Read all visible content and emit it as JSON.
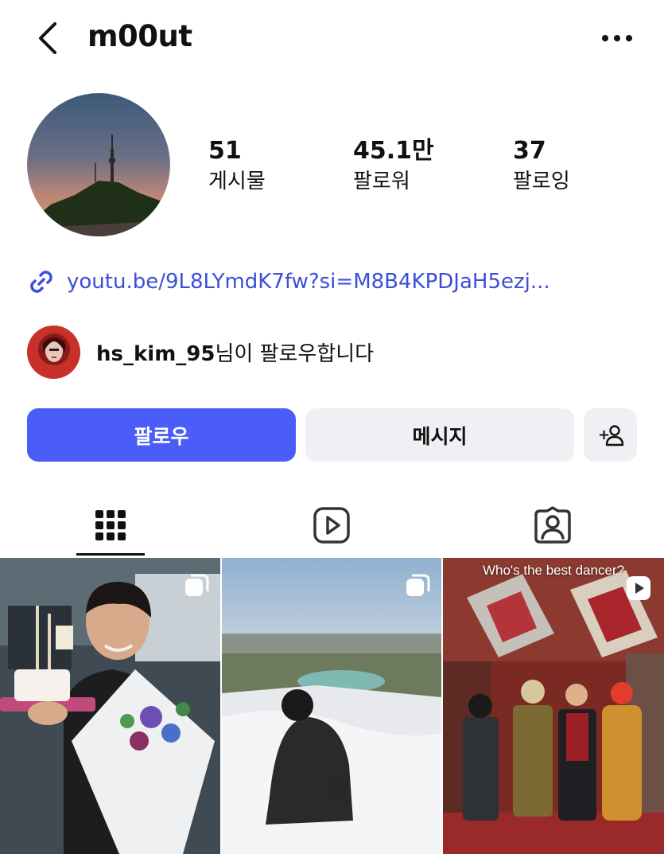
{
  "header": {
    "username": "m00ut",
    "back_icon": "chevron-left-icon",
    "more_icon": "more-horizontal-icon"
  },
  "profile": {
    "stats": [
      {
        "value": "51",
        "label": "게시물"
      },
      {
        "value": "45.1만",
        "label": "팔로워"
      },
      {
        "value": "37",
        "label": "팔로잉"
      }
    ],
    "link": "youtu.be/9L8LYmdK7fw?si=M8B4KPDJaH5ezj...",
    "followed_by": {
      "user": "hs_kim_95",
      "suffix": "님이 팔로우합니다"
    }
  },
  "actions": {
    "follow": "팔로우",
    "message": "메시지",
    "add_user": "+"
  },
  "tabs": [
    {
      "name": "grid",
      "icon": "grid-icon",
      "active": true
    },
    {
      "name": "reels",
      "icon": "reels-icon",
      "active": false
    },
    {
      "name": "tagged",
      "icon": "tagged-person-icon",
      "active": false
    }
  ],
  "posts": [
    {
      "type": "carousel",
      "caption": ""
    },
    {
      "type": "carousel",
      "caption": ""
    },
    {
      "type": "reel",
      "caption": "Who's the best dancer?"
    }
  ],
  "colors": {
    "accent": "#4a5df9",
    "link": "#3b4fd9",
    "secondary_button": "#eef0f3"
  }
}
